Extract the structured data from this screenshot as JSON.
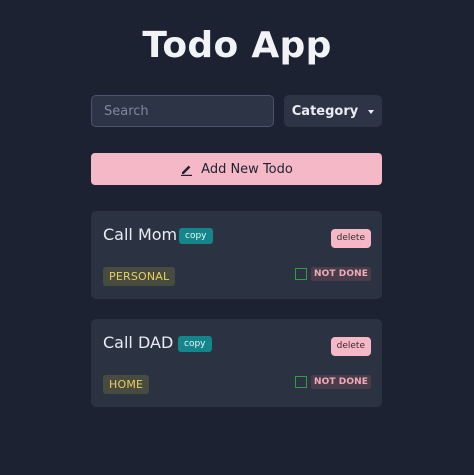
{
  "app": {
    "title": "Todo App"
  },
  "toolbar": {
    "search_placeholder": "Search",
    "category_label": "Category",
    "add_label": "Add New Todo"
  },
  "todos": [
    {
      "name": "Call Mom",
      "copy_label": "copy",
      "delete_label": "delete",
      "category": "PERSONAL",
      "status": "NOT DONE",
      "done": false
    },
    {
      "name": "Call DAD",
      "copy_label": "copy",
      "delete_label": "delete",
      "category": "HOME",
      "status": "NOT DONE",
      "done": false
    }
  ],
  "colors": {
    "background": "#1c2231",
    "card": "#2b3242",
    "accent_pink": "#f5b8c6",
    "copy_teal": "#14858a",
    "category_text": "#e8d05c",
    "checkbox_green": "#2e9d46"
  },
  "icons": {
    "add_button_icon": "pencil-icon",
    "category_icon": "caret-down-icon"
  }
}
